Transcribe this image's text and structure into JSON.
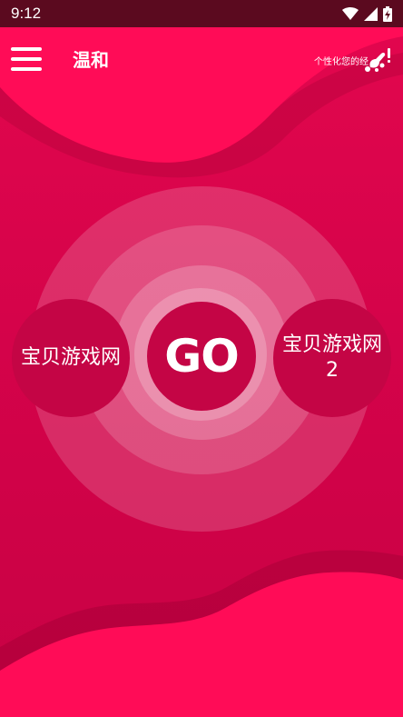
{
  "status_bar": {
    "time": "9:12",
    "icons": [
      "wifi-icon",
      "cellular-signal-icon",
      "battery-charging-icon"
    ]
  },
  "app_bar": {
    "menu_icon": "hamburger-menu-icon",
    "title": "温和",
    "personalize_label": "个性化您的经",
    "personalize_icon": "paint-brush-icon"
  },
  "main": {
    "go_label": "GO",
    "left_button_label": "宝贝游戏网",
    "right_button_label": "宝贝游戏网\n2"
  },
  "colors": {
    "status_bar": "#5b0a1f",
    "background": "#d5034a",
    "wave_light": "#ff0c57",
    "button": "#c40545",
    "text": "#ffffff"
  }
}
